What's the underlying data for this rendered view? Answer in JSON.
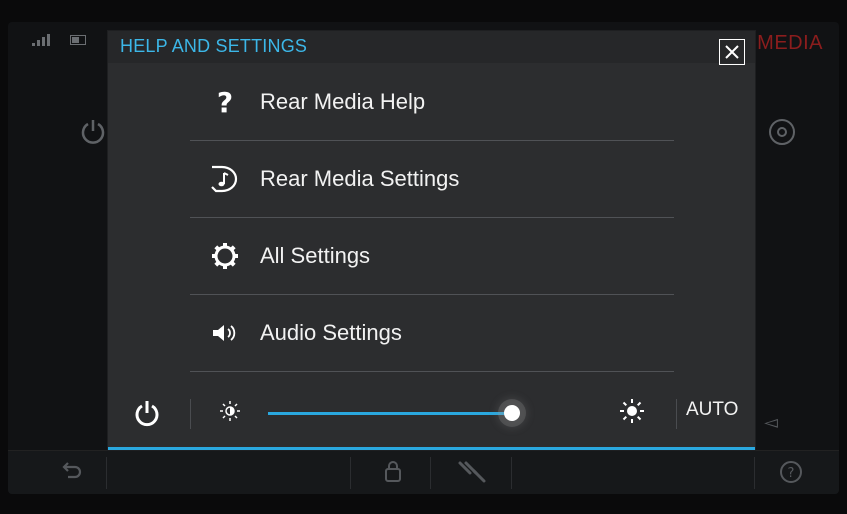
{
  "background_app": {
    "title": "MEDIA"
  },
  "modal": {
    "title": "HELP AND SETTINGS",
    "close_icon": "close-icon",
    "items": [
      {
        "label": "Rear Media Help",
        "icon": "question-icon"
      },
      {
        "label": "Rear Media Settings",
        "icon": "rear-media-icon"
      },
      {
        "label": "All Settings",
        "icon": "gear-icon"
      },
      {
        "label": "Audio Settings",
        "icon": "speaker-icon"
      }
    ],
    "brightness": {
      "auto_label": "AUTO",
      "level": 0.8
    }
  },
  "colors": {
    "accent": "#2aa8df",
    "title": "#3cb7e8",
    "panel": "#2c2d2f",
    "bg_title": "#8b1d1d"
  }
}
